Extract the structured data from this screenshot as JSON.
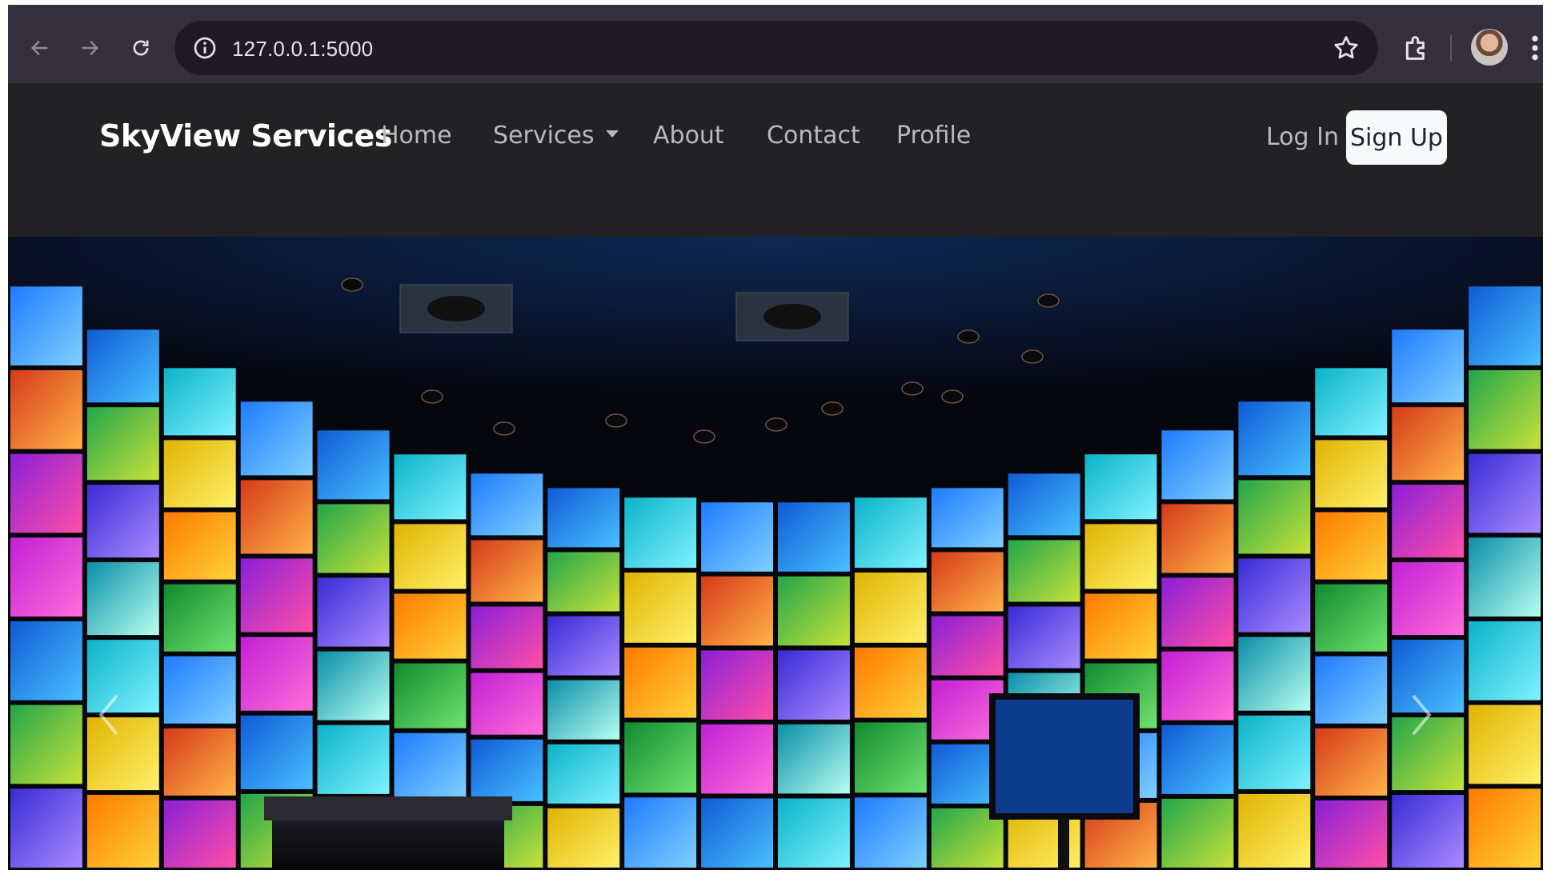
{
  "browser": {
    "url": "127.0.0.1:5000",
    "icons": {
      "back": "arrow-left-icon",
      "forward": "arrow-right-icon",
      "reload": "reload-icon",
      "site_info": "info-icon",
      "bookmark": "star-icon",
      "extensions": "puzzle-icon",
      "menu": "kebab-icon"
    }
  },
  "navbar": {
    "brand": "SkyView Services",
    "links": {
      "home": "Home",
      "services": "Services",
      "about": "About",
      "contact": "Contact",
      "profile": "Profile"
    },
    "login": "Log In",
    "signup": "Sign Up"
  },
  "hero": {
    "image_alt": "Curved video wall of colorful screens",
    "prev_icon": "chevron-left-icon",
    "next_icon": "chevron-right-icon"
  },
  "colors": {
    "chrome_bg": "#35303d",
    "omnibox_bg": "#1f1b25",
    "navbar_bg": "#222224",
    "signup_bg": "#f8f9fa"
  }
}
